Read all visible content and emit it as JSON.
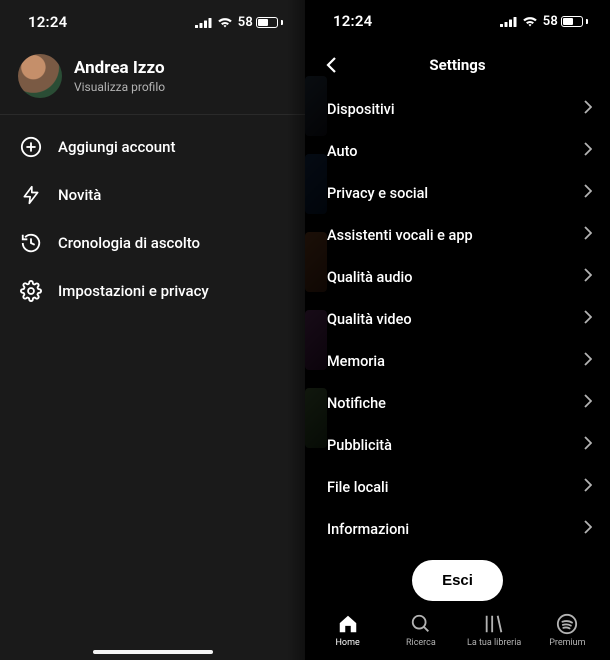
{
  "status": {
    "time": "12:24",
    "battery": "58"
  },
  "left": {
    "profile": {
      "name": "Andrea Izzo",
      "sub": "Visualizza profilo"
    },
    "menu": [
      {
        "icon": "plus-circle-icon",
        "label": "Aggiungi account"
      },
      {
        "icon": "bolt-icon",
        "label": "Novità"
      },
      {
        "icon": "history-icon",
        "label": "Cronologia di ascolto"
      },
      {
        "icon": "gear-icon",
        "label": "Impostazioni e privacy"
      }
    ]
  },
  "right": {
    "title": "Settings",
    "items": [
      "Dispositivi",
      "Auto",
      "Privacy e social",
      "Assistenti vocali e app",
      "Qualità audio",
      "Qualità video",
      "Memoria",
      "Notifiche",
      "Pubblicità",
      "File locali",
      "Informazioni"
    ],
    "logout": "Esci",
    "tabs": [
      {
        "label": "Home",
        "icon": "home-icon",
        "active": true
      },
      {
        "label": "Ricerca",
        "icon": "search-icon",
        "active": false
      },
      {
        "label": "La tua libreria",
        "icon": "library-icon",
        "active": false
      },
      {
        "label": "Premium",
        "icon": "spotify-icon",
        "active": false
      }
    ]
  }
}
